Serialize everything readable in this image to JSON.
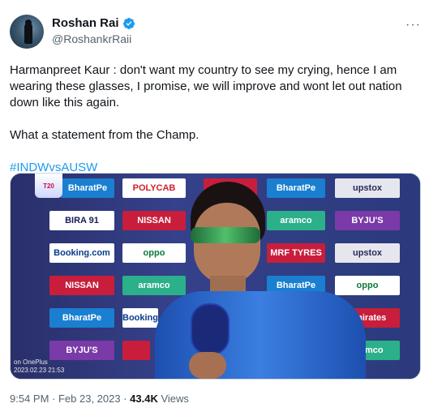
{
  "author": {
    "name": "Roshan Rai",
    "handle": "@RoshankrRaii",
    "avatar_icon": "profile-avatar"
  },
  "more_icon": "more-horizontal-icon",
  "tweet": {
    "line1": "Harmanpreet Kaur : don't want my country to see my crying, hence I am wearing these glasses, I promise, we will improve and wont let out nation down like this again.",
    "line2": "What a statement from the Champ.",
    "hashtag": "#INDWvsAUSW"
  },
  "media": {
    "sponsors": [
      "BharatPe",
      "POLYCAB",
      "BIRA 91",
      "NISSAN",
      "aramco",
      "BYJU'S",
      "Booking.com",
      "oppo",
      "MRF TYRES",
      "upstox",
      "NISSAN",
      "aramco",
      "BharatPe",
      "oppo",
      "BharatPe",
      "Booking",
      "Emirates",
      "BYJU'S",
      "aramco"
    ],
    "watermark_line1": "on OnePlus",
    "watermark_line2": "2023.02.23 21:53",
    "event_logo": "T20"
  },
  "footer": {
    "time": "9:54 PM · Feb 23, 2023 · ",
    "views": "43.4K",
    "views_label": " Views"
  },
  "colors": {
    "accent": "#1d9bf0",
    "secondary_text": "#536471"
  }
}
